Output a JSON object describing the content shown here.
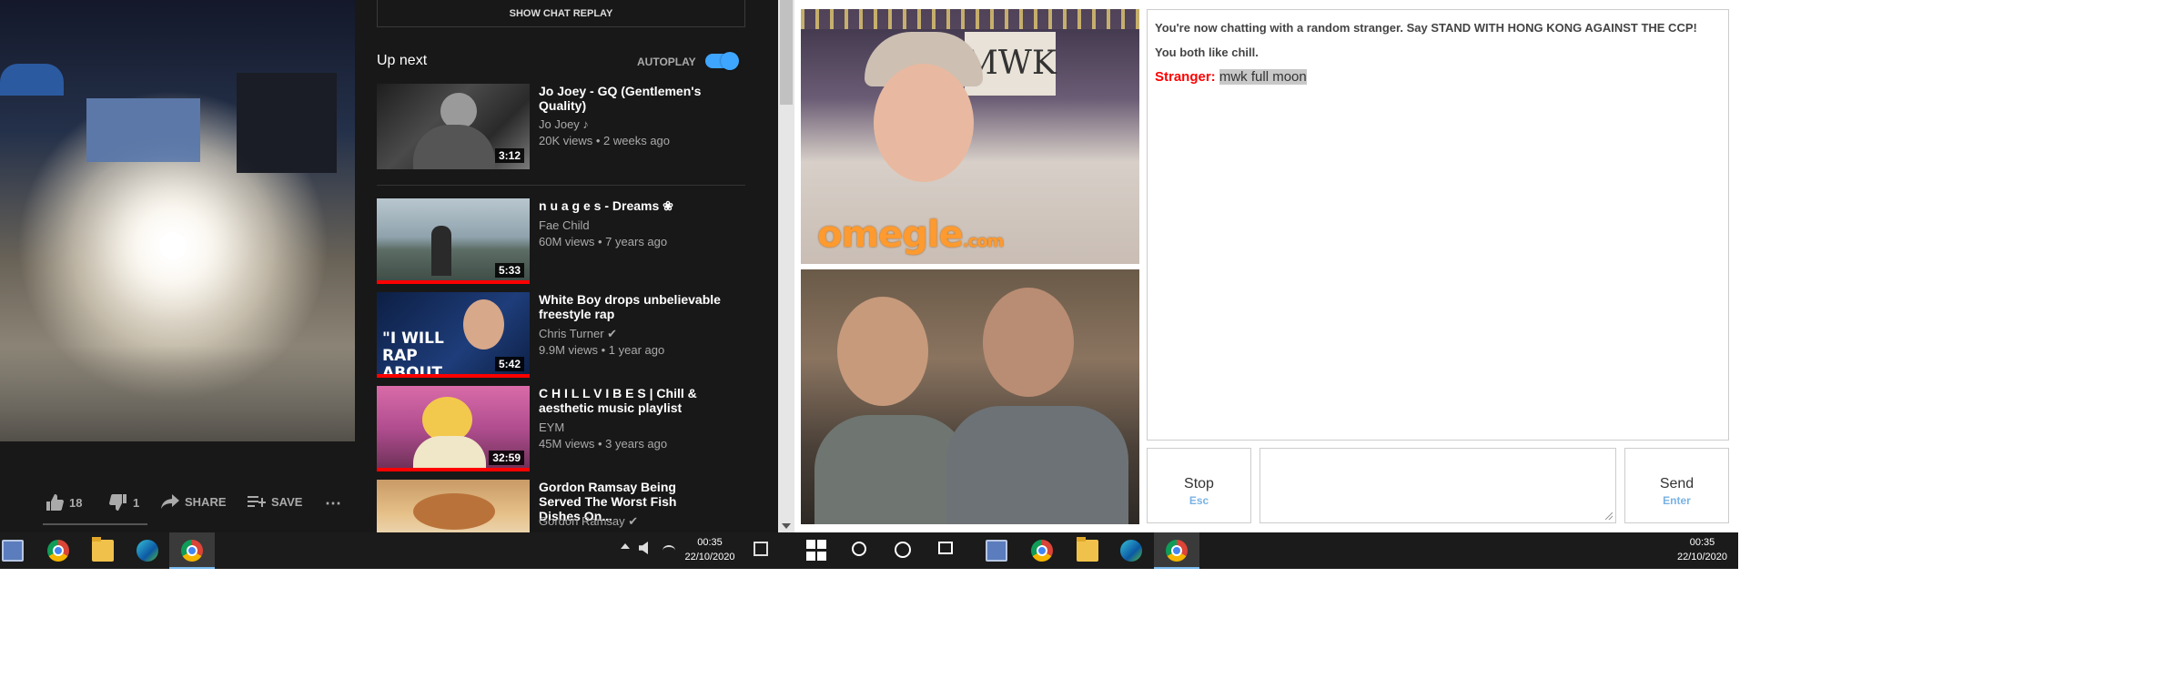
{
  "youtube": {
    "show_chat_replay": "SHOW CHAT REPLAY",
    "up_next": "Up next",
    "autoplay": "AUTOPLAY",
    "autoplay_on": true,
    "videos": [
      {
        "title": "Jo Joey - GQ (Gentlemen's Quality)",
        "channel": "Jo Joey ♪",
        "meta": "20K views • 2 weeks ago",
        "duration": "3:12"
      },
      {
        "title": "n u a g e s - Dreams ❀",
        "channel": "Fae Child",
        "meta": "60M views • 7 years ago",
        "duration": "5:33"
      },
      {
        "title": "White Boy drops unbelievable freestyle rap",
        "channel": "Chris Turner ✔",
        "meta": "9.9M views • 1 year ago",
        "duration": "5:42",
        "thumb_text": "\"I WILL RAP ABOUT ANYTHING\""
      },
      {
        "title": "C H I L L V I B E S | Chill & aesthetic music playlist",
        "channel": "EYM",
        "meta": "45M views • 3 years ago",
        "duration": "32:59"
      },
      {
        "title": "Gordon Ramsay Being Served The Worst Fish Dishes On...",
        "channel": "Gordon Ramsay ✔",
        "meta": "",
        "duration": ""
      }
    ],
    "actions": {
      "likes": "18",
      "dislikes": "1",
      "share": "SHARE",
      "save": "SAVE",
      "more": "⋯"
    }
  },
  "omegle": {
    "watermark": "omegle",
    "watermark_suffix": ".com",
    "stranger_cam_sign": "MWK",
    "intro_line": "You're now chatting with a random stranger. Say STAND WITH HONG KONG AGAINST THE CCP!",
    "likes_line": "You both like chill.",
    "stranger_label": "Stranger:",
    "stranger_message": "mwk full moon",
    "stop_label": "Stop",
    "stop_key": "Esc",
    "send_label": "Send",
    "send_key": "Enter",
    "input_value": ""
  },
  "taskbar_left": {
    "time": "00:35",
    "date": "22/10/2020",
    "tray_icons": [
      "chevron-up-icon",
      "volume-icon",
      "network-icon"
    ]
  },
  "taskbar_right": {
    "time": "00:35",
    "date": "22/10/2020"
  },
  "colors": {
    "youtube_bg": "#181818",
    "progress_red": "#ff0000",
    "autoplay_blue": "#3ea6ff",
    "stranger_red": "#ff0000",
    "key_hint_blue": "#7ab2e4",
    "taskbar_bg": "#1b1b1b"
  }
}
